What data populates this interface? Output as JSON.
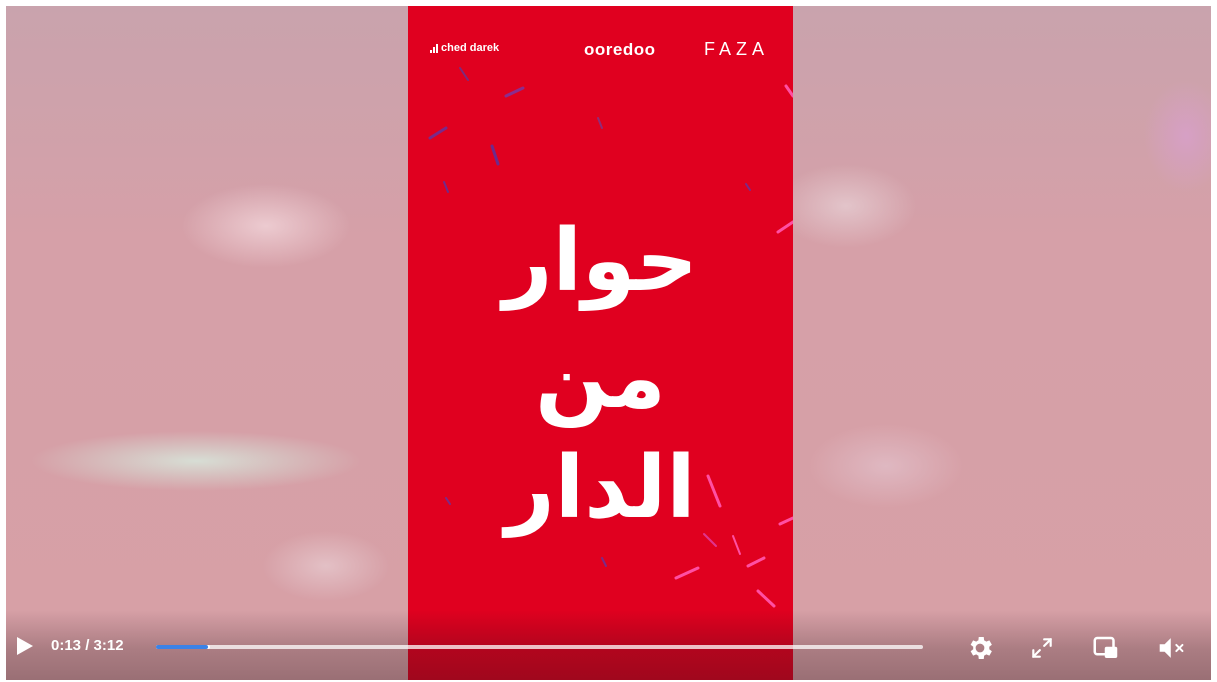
{
  "video": {
    "logo_left": "ched darek",
    "logo_brand": "ooredoo",
    "logo_faza": "FAZA",
    "title_line1": "حوار",
    "title_line2": "من",
    "title_line3": "الدار",
    "background_color": "#e0001f"
  },
  "controls": {
    "current_time": "0:13",
    "separator": " / ",
    "duration": "3:12",
    "progress_fraction": 0.068,
    "buffered_fraction": 0.07,
    "progress_color": "#3b82e6",
    "icons": {
      "play": "play-icon",
      "settings": "gear-icon",
      "fullscreen": "expand-icon",
      "pip": "picture-in-picture-icon",
      "volume": "volume-muted-icon"
    }
  }
}
